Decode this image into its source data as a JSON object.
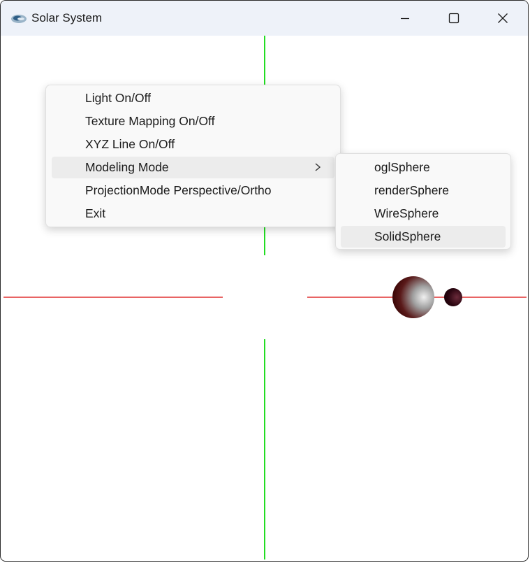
{
  "window": {
    "title": "Solar System",
    "title_icon": "glut-app-icon",
    "controls": [
      "minimize-icon",
      "maximize-icon",
      "close-icon"
    ]
  },
  "scene": {
    "x_axis_color": "#e03030",
    "y_axis_color": "#22dd22",
    "background": "#ffffff",
    "sun_color": "#7a1010",
    "moon_color": "#3a0810"
  },
  "context_menu": {
    "items": [
      {
        "label": "Light On/Off"
      },
      {
        "label": "Texture Mapping On/Off"
      },
      {
        "label": "XYZ Line On/Off"
      },
      {
        "label": "Modeling Mode",
        "submenu_icon": "chevron-right-icon",
        "highlighted": true
      },
      {
        "label": "ProjectionMode Perspective/Ortho"
      },
      {
        "label": "Exit"
      }
    ],
    "submenu": {
      "items": [
        {
          "label": "oglSphere"
        },
        {
          "label": "renderSphere"
        },
        {
          "label": "WireSphere"
        },
        {
          "label": "SolidSphere",
          "highlighted": true
        }
      ]
    }
  }
}
